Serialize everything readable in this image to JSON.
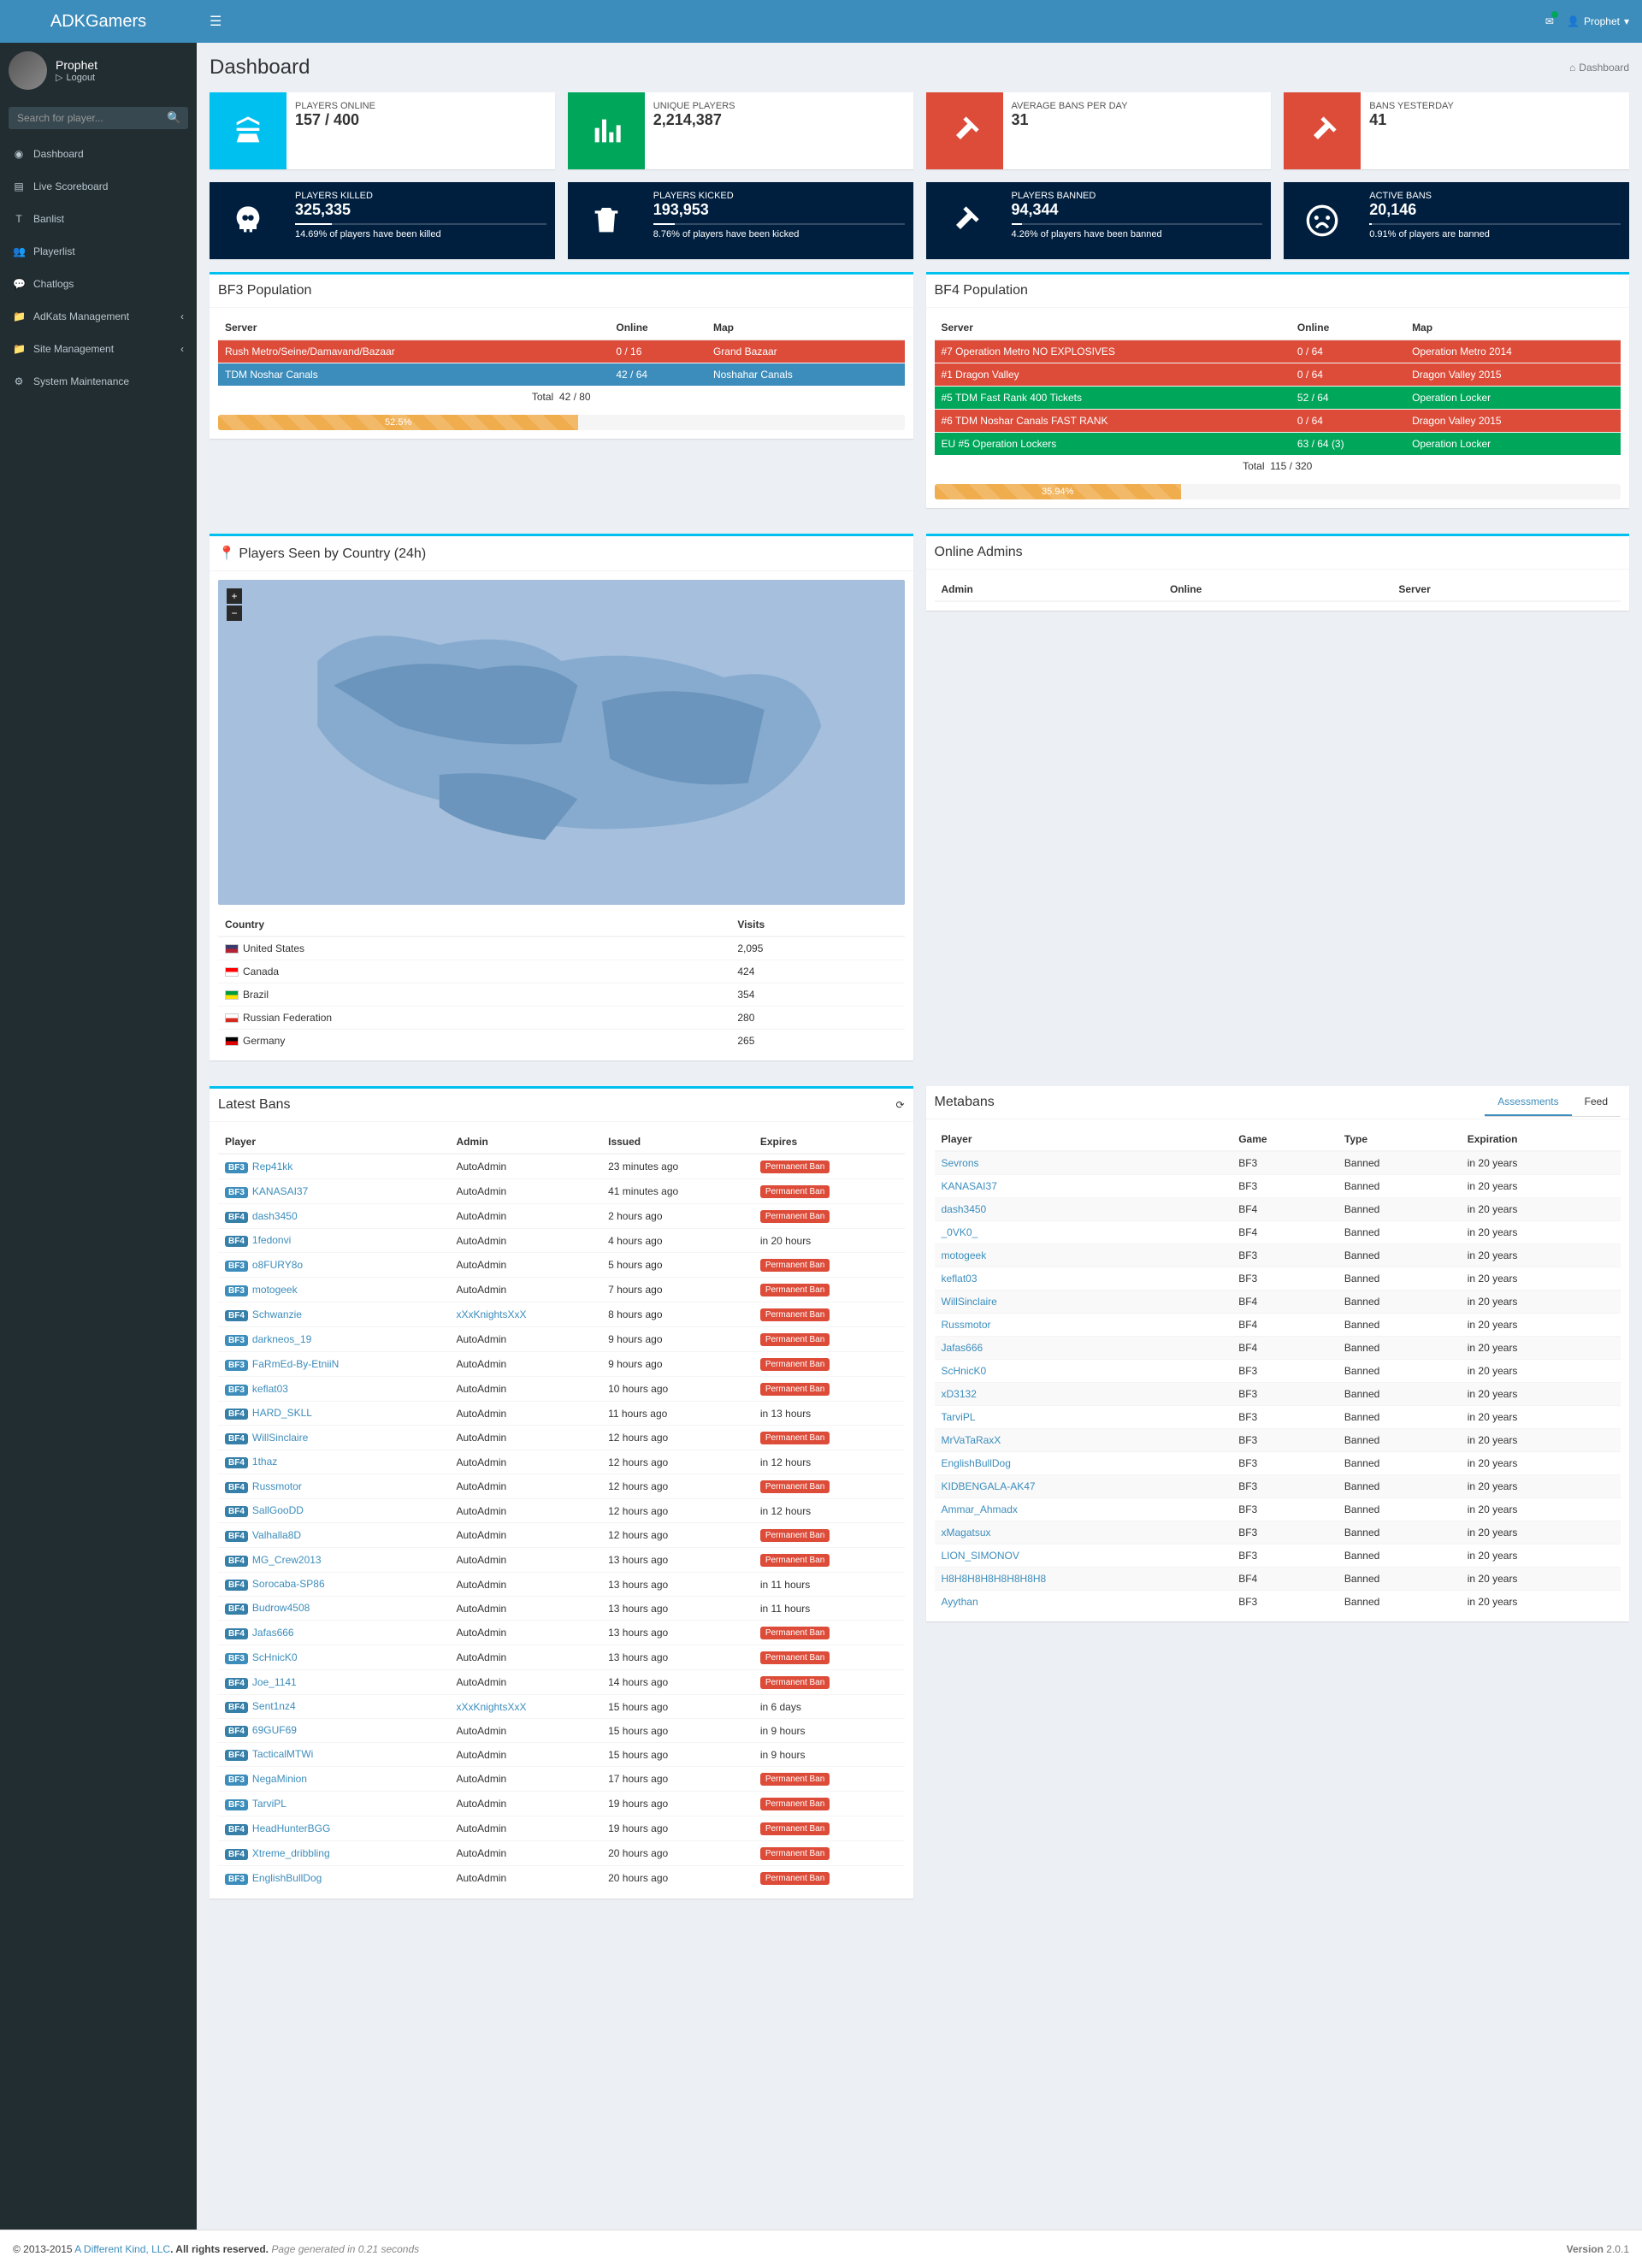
{
  "brand": "ADKGamers",
  "user": {
    "name": "Prophet",
    "logout": "Logout"
  },
  "search": {
    "placeholder": "Search for player..."
  },
  "sidebar": {
    "items": [
      {
        "label": "Dashboard",
        "icon": "dashboard"
      },
      {
        "label": "Live Scoreboard",
        "icon": "server"
      },
      {
        "label": "Banlist",
        "icon": "text"
      },
      {
        "label": "Playerlist",
        "icon": "users"
      },
      {
        "label": "Chatlogs",
        "icon": "comments"
      },
      {
        "label": "AdKats Management",
        "icon": "folder",
        "arrow": true
      },
      {
        "label": "Site Management",
        "icon": "folder",
        "arrow": true
      },
      {
        "label": "System Maintenance",
        "icon": "cogs"
      }
    ]
  },
  "page": {
    "title": "Dashboard",
    "breadcrumb": "Dashboard"
  },
  "stats": [
    {
      "label": "PLAYERS ONLINE",
      "value": "157 / 400",
      "bg": "aqua",
      "icon": "scale"
    },
    {
      "label": "UNIQUE PLAYERS",
      "value": "2,214,387",
      "bg": "green",
      "icon": "bar"
    },
    {
      "label": "AVERAGE BANS PER DAY",
      "value": "31",
      "bg": "red",
      "icon": "hammer"
    },
    {
      "label": "BANS YESTERDAY",
      "value": "41",
      "bg": "red",
      "icon": "hammer"
    }
  ],
  "stats2": [
    {
      "label": "PLAYERS KILLED",
      "value": "325,335",
      "desc": "14.69% of players have been killed",
      "pct": 14.69,
      "icon": "skull"
    },
    {
      "label": "PLAYERS KICKED",
      "value": "193,953",
      "desc": "8.76% of players have been kicked",
      "pct": 8.76,
      "icon": "trash"
    },
    {
      "label": "PLAYERS BANNED",
      "value": "94,344",
      "desc": "4.26% of players have been banned",
      "pct": 4.26,
      "icon": "hammer"
    },
    {
      "label": "ACTIVE BANS",
      "value": "20,146",
      "desc": "0.91% of players are banned",
      "pct": 0.91,
      "icon": "frown"
    }
  ],
  "bf3": {
    "title": "BF3 Population",
    "headers": {
      "server": "Server",
      "online": "Online",
      "map": "Map"
    },
    "rows": [
      {
        "server": "Rush Metro/Seine/Damavand/Bazaar",
        "online": "0 / 16",
        "map": "Grand Bazaar",
        "cls": "server-red"
      },
      {
        "server": "TDM Noshar Canals",
        "online": "42 / 64",
        "map": "Noshahar Canals",
        "cls": "server-blue"
      }
    ],
    "total_label": "Total",
    "total": "42 / 80",
    "pct": 52.5,
    "pct_text": "52.5%"
  },
  "bf4": {
    "title": "BF4 Population",
    "headers": {
      "server": "Server",
      "online": "Online",
      "map": "Map"
    },
    "rows": [
      {
        "server": "#7 Operation Metro NO EXPLOSIVES",
        "online": "0 / 64",
        "map": "Operation Metro 2014",
        "cls": "server-red"
      },
      {
        "server": "#1 Dragon Valley",
        "online": "0 / 64",
        "map": "Dragon Valley 2015",
        "cls": "server-red"
      },
      {
        "server": "#5 TDM Fast Rank 400 Tickets",
        "online": "52 / 64",
        "map": "Operation Locker",
        "cls": "server-green"
      },
      {
        "server": "#6 TDM Noshar Canals FAST RANK",
        "online": "0 / 64",
        "map": "Dragon Valley 2015",
        "cls": "server-red"
      },
      {
        "server": "EU #5 Operation Lockers",
        "online": "63 / 64 (3)",
        "map": "Operation Locker",
        "cls": "server-green"
      }
    ],
    "total_label": "Total",
    "total": "115 / 320",
    "pct": 35.94,
    "pct_text": "35.94%"
  },
  "map_box": {
    "title": "Players Seen by Country (24h)",
    "headers": {
      "country": "Country",
      "visits": "Visits"
    },
    "rows": [
      {
        "country": "United States",
        "visits": "2,095",
        "flag": "#3c3b6e,#b22234"
      },
      {
        "country": "Canada",
        "visits": "424",
        "flag": "#ff0000,#ffffff"
      },
      {
        "country": "Brazil",
        "visits": "354",
        "flag": "#009b3a,#fedf00"
      },
      {
        "country": "Russian Federation",
        "visits": "280",
        "flag": "#ffffff,#d52b1e"
      },
      {
        "country": "Germany",
        "visits": "265",
        "flag": "#000000,#dd0000"
      }
    ]
  },
  "online_admins": {
    "title": "Online Admins",
    "headers": {
      "admin": "Admin",
      "online": "Online",
      "server": "Server"
    }
  },
  "latest_bans": {
    "title": "Latest Bans",
    "headers": {
      "player": "Player",
      "admin": "Admin",
      "issued": "Issued",
      "expires": "Expires"
    },
    "perm_label": "Permanent Ban",
    "rows": [
      {
        "game": "BF3",
        "player": "Rep41kk",
        "admin": "AutoAdmin",
        "issued": "23 minutes ago",
        "expires": "perm"
      },
      {
        "game": "BF3",
        "player": "KANASAI37",
        "admin": "AutoAdmin",
        "issued": "41 minutes ago",
        "expires": "perm"
      },
      {
        "game": "BF4",
        "player": "dash3450",
        "admin": "AutoAdmin",
        "issued": "2 hours ago",
        "expires": "perm"
      },
      {
        "game": "BF4",
        "player": "1fedonvi",
        "admin": "AutoAdmin",
        "issued": "4 hours ago",
        "expires": "in 20 hours"
      },
      {
        "game": "BF3",
        "player": "o8FURY8o",
        "admin": "AutoAdmin",
        "issued": "5 hours ago",
        "expires": "perm"
      },
      {
        "game": "BF3",
        "player": "motogeek",
        "admin": "AutoAdmin",
        "issued": "7 hours ago",
        "expires": "perm"
      },
      {
        "game": "BF4",
        "player": "Schwanzie",
        "admin": "xXxKnightsXxX",
        "admin_link": true,
        "issued": "8 hours ago",
        "expires": "perm"
      },
      {
        "game": "BF3",
        "player": "darkneos_19",
        "admin": "AutoAdmin",
        "issued": "9 hours ago",
        "expires": "perm"
      },
      {
        "game": "BF3",
        "player": "FaRmEd-By-EtniiN",
        "admin": "AutoAdmin",
        "issued": "9 hours ago",
        "expires": "perm"
      },
      {
        "game": "BF3",
        "player": "keflat03",
        "admin": "AutoAdmin",
        "issued": "10 hours ago",
        "expires": "perm"
      },
      {
        "game": "BF4",
        "player": "HARD_SKLL",
        "admin": "AutoAdmin",
        "issued": "11 hours ago",
        "expires": "in 13 hours"
      },
      {
        "game": "BF4",
        "player": "WillSinclaire",
        "admin": "AutoAdmin",
        "issued": "12 hours ago",
        "expires": "perm"
      },
      {
        "game": "BF4",
        "player": "1thaz",
        "admin": "AutoAdmin",
        "issued": "12 hours ago",
        "expires": "in 12 hours"
      },
      {
        "game": "BF4",
        "player": "Russmotor",
        "admin": "AutoAdmin",
        "issued": "12 hours ago",
        "expires": "perm"
      },
      {
        "game": "BF4",
        "player": "SallGooDD",
        "admin": "AutoAdmin",
        "issued": "12 hours ago",
        "expires": "in 12 hours"
      },
      {
        "game": "BF4",
        "player": "Valhalla8D",
        "admin": "AutoAdmin",
        "issued": "12 hours ago",
        "expires": "perm"
      },
      {
        "game": "BF4",
        "player": "MG_Crew2013",
        "admin": "AutoAdmin",
        "issued": "13 hours ago",
        "expires": "perm"
      },
      {
        "game": "BF4",
        "player": "Sorocaba-SP86",
        "admin": "AutoAdmin",
        "issued": "13 hours ago",
        "expires": "in 11 hours"
      },
      {
        "game": "BF4",
        "player": "Budrow4508",
        "admin": "AutoAdmin",
        "issued": "13 hours ago",
        "expires": "in 11 hours"
      },
      {
        "game": "BF4",
        "player": "Jafas666",
        "admin": "AutoAdmin",
        "issued": "13 hours ago",
        "expires": "perm"
      },
      {
        "game": "BF3",
        "player": "ScHnicK0",
        "admin": "AutoAdmin",
        "issued": "13 hours ago",
        "expires": "perm"
      },
      {
        "game": "BF4",
        "player": "Joe_1141",
        "admin": "AutoAdmin",
        "issued": "14 hours ago",
        "expires": "perm"
      },
      {
        "game": "BF4",
        "player": "Sent1nz4",
        "admin": "xXxKnightsXxX",
        "admin_link": true,
        "issued": "15 hours ago",
        "expires": "in 6 days"
      },
      {
        "game": "BF4",
        "player": "69GUF69",
        "admin": "AutoAdmin",
        "issued": "15 hours ago",
        "expires": "in 9 hours"
      },
      {
        "game": "BF4",
        "player": "TacticalMTWi",
        "admin": "AutoAdmin",
        "issued": "15 hours ago",
        "expires": "in 9 hours"
      },
      {
        "game": "BF3",
        "player": "NegaMinion",
        "admin": "AutoAdmin",
        "issued": "17 hours ago",
        "expires": "perm"
      },
      {
        "game": "BF3",
        "player": "TarviPL",
        "admin": "AutoAdmin",
        "issued": "19 hours ago",
        "expires": "perm"
      },
      {
        "game": "BF4",
        "player": "HeadHunterBGG",
        "admin": "AutoAdmin",
        "issued": "19 hours ago",
        "expires": "perm"
      },
      {
        "game": "BF4",
        "player": "Xtreme_dribbling",
        "admin": "AutoAdmin",
        "issued": "20 hours ago",
        "expires": "perm"
      },
      {
        "game": "BF3",
        "player": "EnglishBullDog",
        "admin": "AutoAdmin",
        "issued": "20 hours ago",
        "expires": "perm"
      }
    ]
  },
  "metabans": {
    "title": "Metabans",
    "tabs": [
      "Assessments",
      "Feed"
    ],
    "headers": {
      "player": "Player",
      "game": "Game",
      "type": "Type",
      "expiration": "Expiration"
    },
    "rows": [
      {
        "player": "Sevrons",
        "game": "BF3",
        "type": "Banned",
        "exp": "in 20 years"
      },
      {
        "player": "KANASAI37",
        "game": "BF3",
        "type": "Banned",
        "exp": "in 20 years"
      },
      {
        "player": "dash3450",
        "game": "BF4",
        "type": "Banned",
        "exp": "in 20 years"
      },
      {
        "player": "_0VK0_",
        "game": "BF4",
        "type": "Banned",
        "exp": "in 20 years"
      },
      {
        "player": "motogeek",
        "game": "BF3",
        "type": "Banned",
        "exp": "in 20 years"
      },
      {
        "player": "keflat03",
        "game": "BF3",
        "type": "Banned",
        "exp": "in 20 years"
      },
      {
        "player": "WillSinclaire",
        "game": "BF4",
        "type": "Banned",
        "exp": "in 20 years"
      },
      {
        "player": "Russmotor",
        "game": "BF4",
        "type": "Banned",
        "exp": "in 20 years"
      },
      {
        "player": "Jafas666",
        "game": "BF4",
        "type": "Banned",
        "exp": "in 20 years"
      },
      {
        "player": "ScHnicK0",
        "game": "BF3",
        "type": "Banned",
        "exp": "in 20 years"
      },
      {
        "player": "xD3132",
        "game": "BF3",
        "type": "Banned",
        "exp": "in 20 years"
      },
      {
        "player": "TarviPL",
        "game": "BF3",
        "type": "Banned",
        "exp": "in 20 years"
      },
      {
        "player": "MrVaTaRaxX",
        "game": "BF3",
        "type": "Banned",
        "exp": "in 20 years"
      },
      {
        "player": "EnglishBullDog",
        "game": "BF3",
        "type": "Banned",
        "exp": "in 20 years"
      },
      {
        "player": "KIDBENGALA-AK47",
        "game": "BF3",
        "type": "Banned",
        "exp": "in 20 years"
      },
      {
        "player": "Ammar_Ahmadx",
        "game": "BF3",
        "type": "Banned",
        "exp": "in 20 years"
      },
      {
        "player": "xMagatsux",
        "game": "BF3",
        "type": "Banned",
        "exp": "in 20 years"
      },
      {
        "player": "LION_SIMONOV",
        "game": "BF3",
        "type": "Banned",
        "exp": "in 20 years"
      },
      {
        "player": "H8H8H8H8H8H8H8H8",
        "game": "BF4",
        "type": "Banned",
        "exp": "in 20 years"
      },
      {
        "player": "Ayythan",
        "game": "BF3",
        "type": "Banned",
        "exp": "in 20 years"
      }
    ]
  },
  "footer": {
    "copyright": "© 2013-2015 ",
    "link": "A Different Kind, LLC",
    "rights": ". All rights reserved. ",
    "gen": "Page generated in 0.21 seconds",
    "version_label": "Version ",
    "version": "2.0.1"
  }
}
